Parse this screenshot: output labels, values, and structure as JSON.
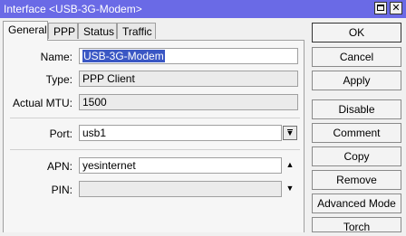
{
  "window": {
    "title": "Interface <USB-3G-Modem>",
    "close_glyph": "✕"
  },
  "tabs": [
    {
      "label": "General"
    },
    {
      "label": "PPP"
    },
    {
      "label": "Status"
    },
    {
      "label": "Traffic"
    }
  ],
  "active_tab": "General",
  "form": {
    "name": {
      "label": "Name:",
      "value": "USB-3G-Modem"
    },
    "type": {
      "label": "Type:",
      "value": "PPP Client"
    },
    "mtu": {
      "label": "Actual MTU:",
      "value": "1500"
    },
    "port": {
      "label": "Port:",
      "value": "usb1"
    },
    "apn": {
      "label": "APN:",
      "value": "yesinternet"
    },
    "pin": {
      "label": "PIN:",
      "value": ""
    }
  },
  "glyphs": {
    "dropdown": "▼",
    "collapse": "▲",
    "expand": "▼"
  },
  "buttons": [
    {
      "label": "OK"
    },
    {
      "label": "Cancel"
    },
    {
      "label": "Apply"
    },
    {
      "label": "Disable"
    },
    {
      "label": "Comment"
    },
    {
      "label": "Copy"
    },
    {
      "label": "Remove"
    },
    {
      "label": "Advanced Mode"
    },
    {
      "label": "Torch"
    }
  ],
  "colors": {
    "titlebar": "#6a6ae6",
    "selection": "#3a57c4",
    "window_bg": "#f0f0f0"
  }
}
